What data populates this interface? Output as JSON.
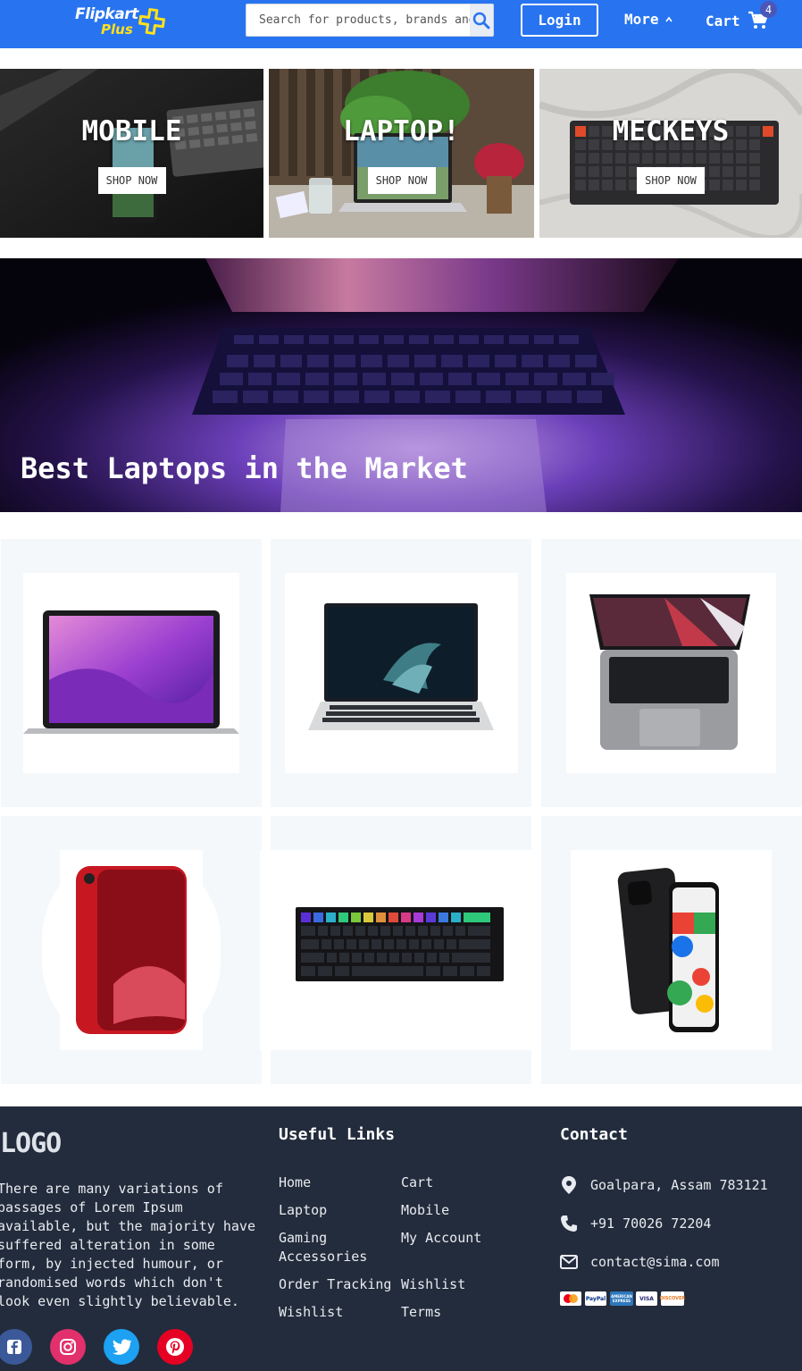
{
  "header": {
    "logo_main": "Flipkart",
    "logo_sub": "Plus",
    "search_placeholder": "Search for products, brands and more",
    "login_label": "Login",
    "more_label": "More",
    "cart_label": "Cart",
    "cart_count": "4",
    "brand_color": "#2874f0"
  },
  "categories": [
    {
      "title": "MOBILE",
      "button": "SHOP NOW"
    },
    {
      "title": "LAPTOP!",
      "button": "SHOP NOW"
    },
    {
      "title": "MECKEYS",
      "button": "SHOP NOW"
    }
  ],
  "hero": {
    "title": "Best Laptops in the Market"
  },
  "footer": {
    "logo": "LOGO",
    "description": "There are many variations of passages of Lorem Ipsum available, but the majority have suffered alteration in some form, by injected humour, or randomised words which don't look even slightly believable.",
    "useful_links_heading": "Useful Links",
    "links_col1": [
      "Home",
      "Laptop",
      "Gaming Accessories",
      "Order Tracking",
      "Wishlist"
    ],
    "links_col2": [
      "Cart",
      "Mobile",
      "My Account",
      "Wishlist",
      "Terms"
    ],
    "contact_heading": "Contact",
    "address": "Goalpara, Assam 783121",
    "phone": "+91 70026 72204",
    "email": "contact@sima.com",
    "payment_methods": [
      "MasterCard",
      "PayPal",
      "AMERICAN EXPRESS",
      "VISA",
      "DISCOVER"
    ],
    "social": [
      "facebook-icon",
      "instagram-icon",
      "twitter-icon",
      "pinterest-icon"
    ]
  }
}
